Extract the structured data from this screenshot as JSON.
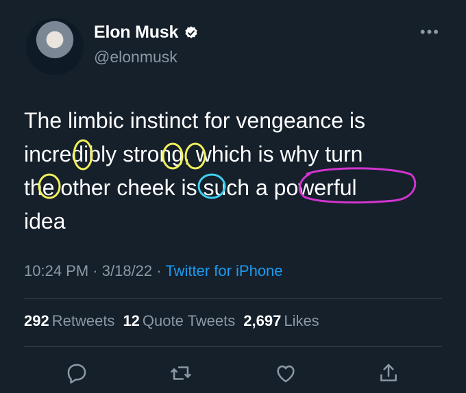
{
  "author": {
    "name": "Elon Musk",
    "handle": "@elonmusk",
    "avatar_icon": "profile-photo",
    "verified_icon": "verified-badge-icon"
  },
  "menu_icon": "more-icon",
  "tweet": {
    "text_lines": [
      "The limbic instinct for vengeance is",
      "incredibly strong, which is why turn",
      "the other cheek is such a powerful",
      "idea"
    ]
  },
  "meta": {
    "time": "10:24 PM",
    "date": "3/18/22",
    "separator": "·",
    "source": "Twitter for iPhone"
  },
  "stats": {
    "retweets_count": "292",
    "retweets_label": "Retweets",
    "quotes_count": "12",
    "quotes_label": "Quote Tweets",
    "likes_count": "2,697",
    "likes_label": "Likes"
  },
  "actions": [
    "reply-icon",
    "retweet-icon",
    "like-icon",
    "share-icon"
  ],
  "colors": {
    "background": "#15202b",
    "muted": "#8b98a5",
    "link": "#1d9bf0",
    "annotation_yellow": "#f2f05a",
    "annotation_cyan": "#3fd1ef",
    "annotation_magenta": "#d234cf"
  }
}
